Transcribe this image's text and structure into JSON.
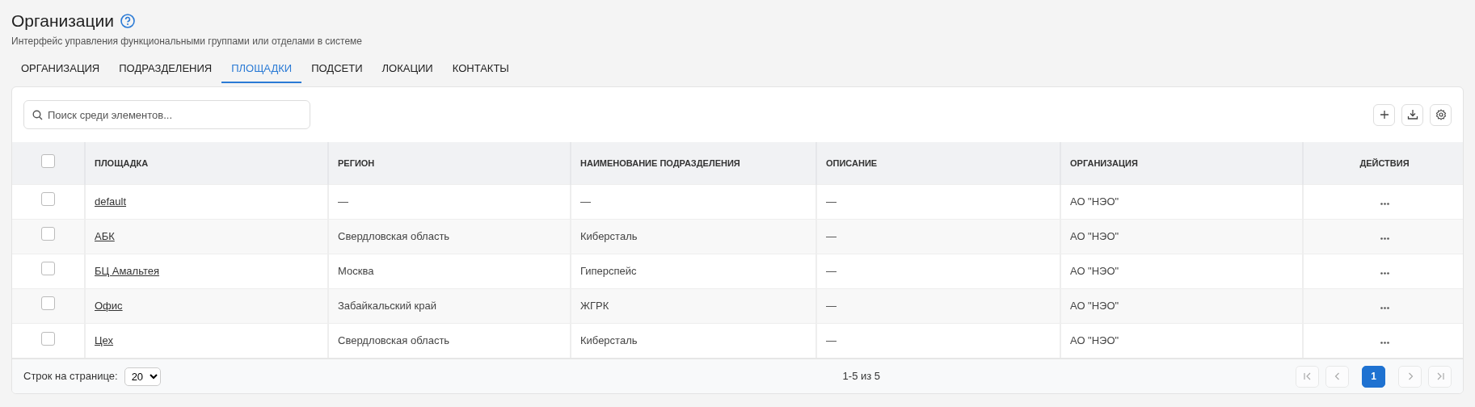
{
  "header": {
    "title": "Организации",
    "subtitle": "Интерфейс управления функциональными группами или отделами в системе"
  },
  "tabs": [
    {
      "label": "ОРГАНИЗАЦИЯ",
      "selected": false
    },
    {
      "label": "ПОДРАЗДЕЛЕНИЯ",
      "selected": false
    },
    {
      "label": "ПЛОЩАДКИ",
      "selected": true
    },
    {
      "label": "ПОДСЕТИ",
      "selected": false
    },
    {
      "label": "ЛОКАЦИИ",
      "selected": false
    },
    {
      "label": "КОНТАКТЫ",
      "selected": false
    }
  ],
  "search": {
    "placeholder": "Поиск среди элементов..."
  },
  "table": {
    "select_all_checked": false,
    "columns": [
      "ПЛОЩАДКА",
      "РЕГИОН",
      "НАИМЕНОВАНИЕ ПОДРАЗДЕЛЕНИЯ",
      "ОПИСАНИЕ",
      "ОРГАНИЗАЦИЯ",
      "ДЕЙСТВИЯ"
    ],
    "rows": [
      {
        "checked": false,
        "cells": [
          "default",
          "—",
          "—",
          "—",
          "АО \"НЭО\""
        ]
      },
      {
        "checked": false,
        "cells": [
          "АБК",
          "Свердловская область",
          "Киберсталь",
          "—",
          "АО \"НЭО\""
        ]
      },
      {
        "checked": false,
        "cells": [
          "БЦ Амальтея",
          "Москва",
          "Гиперспейс",
          "—",
          "АО \"НЭО\""
        ]
      },
      {
        "checked": false,
        "cells": [
          "Офис",
          "Забайкальский край",
          "ЖГРК",
          "—",
          "АО \"НЭО\""
        ]
      },
      {
        "checked": false,
        "cells": [
          "Цех",
          "Свердловская область",
          "Киберсталь",
          "—",
          "АО \"НЭО\""
        ]
      }
    ]
  },
  "footer": {
    "rows_label": "Строк на странице:",
    "rows_per_page": "20",
    "range": "1-5 из 5",
    "pages": [
      {
        "label": "1",
        "selected": true
      }
    ],
    "nav": [
      {
        "kind": "first",
        "disabled": true
      },
      {
        "kind": "prev",
        "disabled": true
      },
      {
        "kind": "next",
        "disabled": true
      },
      {
        "kind": "last",
        "disabled": true
      }
    ]
  }
}
